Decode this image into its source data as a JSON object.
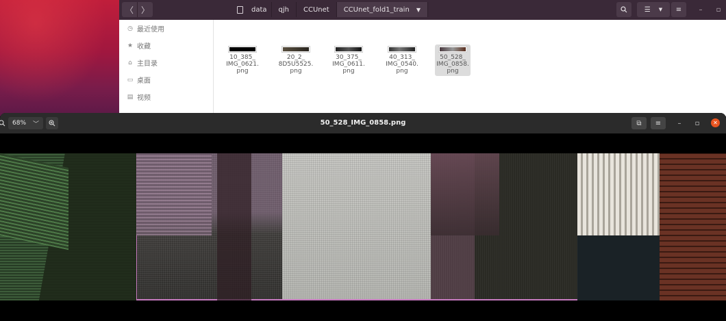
{
  "file_manager": {
    "nav": {
      "back_icon": "chevron-left-icon",
      "forward_icon": "chevron-right-icon"
    },
    "breadcrumbs": [
      {
        "label": "data"
      },
      {
        "label": "qjh"
      },
      {
        "label": "CCUnet"
      },
      {
        "label": "CCUnet_fold1_train"
      }
    ],
    "sidebar": {
      "items": [
        {
          "label": "最近使用",
          "icon": "clock-icon"
        },
        {
          "label": "收藏",
          "icon": "star-icon"
        },
        {
          "label": "主目录",
          "icon": "home-icon"
        },
        {
          "label": "桌面",
          "icon": "desktop-icon"
        },
        {
          "label": "视频",
          "icon": "video-icon"
        }
      ]
    },
    "files": [
      {
        "name_lines": [
          "10_385_",
          "IMG_0621.",
          "png"
        ]
      },
      {
        "name_lines": [
          "20_2_",
          "8D5U5525.",
          "png"
        ]
      },
      {
        "name_lines": [
          "30_375_",
          "IMG_0611.",
          "png"
        ]
      },
      {
        "name_lines": [
          "40_313_",
          "IMG_0540.",
          "png"
        ]
      },
      {
        "name_lines": [
          "50_528_",
          "IMG_0858.",
          "png"
        ],
        "selected": true
      }
    ]
  },
  "viewer": {
    "title": "50_528_IMG_0858.png",
    "zoom": "68%"
  }
}
